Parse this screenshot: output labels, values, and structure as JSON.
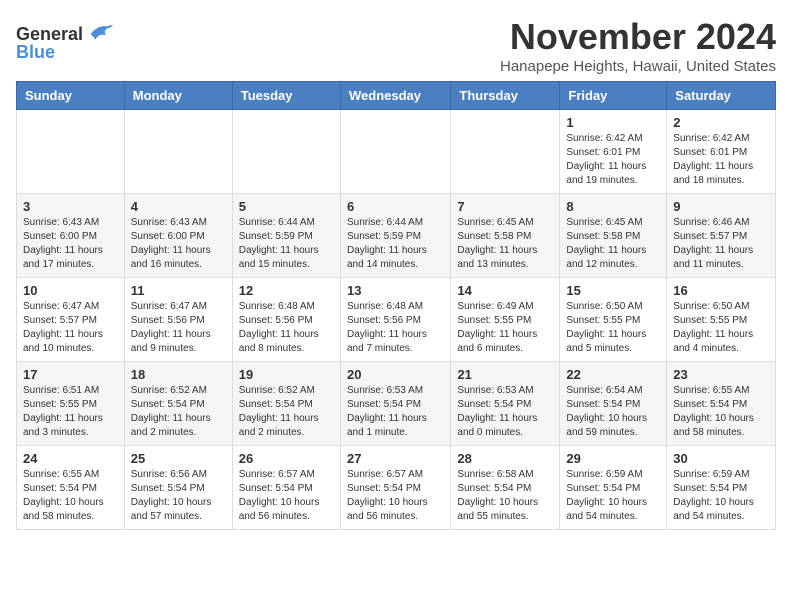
{
  "header": {
    "logo_general": "General",
    "logo_blue": "Blue",
    "title": "November 2024",
    "subtitle": "Hanapepe Heights, Hawaii, United States"
  },
  "weekdays": [
    "Sunday",
    "Monday",
    "Tuesday",
    "Wednesday",
    "Thursday",
    "Friday",
    "Saturday"
  ],
  "weeks": [
    [
      {
        "day": "",
        "info": ""
      },
      {
        "day": "",
        "info": ""
      },
      {
        "day": "",
        "info": ""
      },
      {
        "day": "",
        "info": ""
      },
      {
        "day": "",
        "info": ""
      },
      {
        "day": "1",
        "info": "Sunrise: 6:42 AM\nSunset: 6:01 PM\nDaylight: 11 hours and 19 minutes."
      },
      {
        "day": "2",
        "info": "Sunrise: 6:42 AM\nSunset: 6:01 PM\nDaylight: 11 hours and 18 minutes."
      }
    ],
    [
      {
        "day": "3",
        "info": "Sunrise: 6:43 AM\nSunset: 6:00 PM\nDaylight: 11 hours and 17 minutes."
      },
      {
        "day": "4",
        "info": "Sunrise: 6:43 AM\nSunset: 6:00 PM\nDaylight: 11 hours and 16 minutes."
      },
      {
        "day": "5",
        "info": "Sunrise: 6:44 AM\nSunset: 5:59 PM\nDaylight: 11 hours and 15 minutes."
      },
      {
        "day": "6",
        "info": "Sunrise: 6:44 AM\nSunset: 5:59 PM\nDaylight: 11 hours and 14 minutes."
      },
      {
        "day": "7",
        "info": "Sunrise: 6:45 AM\nSunset: 5:58 PM\nDaylight: 11 hours and 13 minutes."
      },
      {
        "day": "8",
        "info": "Sunrise: 6:45 AM\nSunset: 5:58 PM\nDaylight: 11 hours and 12 minutes."
      },
      {
        "day": "9",
        "info": "Sunrise: 6:46 AM\nSunset: 5:57 PM\nDaylight: 11 hours and 11 minutes."
      }
    ],
    [
      {
        "day": "10",
        "info": "Sunrise: 6:47 AM\nSunset: 5:57 PM\nDaylight: 11 hours and 10 minutes."
      },
      {
        "day": "11",
        "info": "Sunrise: 6:47 AM\nSunset: 5:56 PM\nDaylight: 11 hours and 9 minutes."
      },
      {
        "day": "12",
        "info": "Sunrise: 6:48 AM\nSunset: 5:56 PM\nDaylight: 11 hours and 8 minutes."
      },
      {
        "day": "13",
        "info": "Sunrise: 6:48 AM\nSunset: 5:56 PM\nDaylight: 11 hours and 7 minutes."
      },
      {
        "day": "14",
        "info": "Sunrise: 6:49 AM\nSunset: 5:55 PM\nDaylight: 11 hours and 6 minutes."
      },
      {
        "day": "15",
        "info": "Sunrise: 6:50 AM\nSunset: 5:55 PM\nDaylight: 11 hours and 5 minutes."
      },
      {
        "day": "16",
        "info": "Sunrise: 6:50 AM\nSunset: 5:55 PM\nDaylight: 11 hours and 4 minutes."
      }
    ],
    [
      {
        "day": "17",
        "info": "Sunrise: 6:51 AM\nSunset: 5:55 PM\nDaylight: 11 hours and 3 minutes."
      },
      {
        "day": "18",
        "info": "Sunrise: 6:52 AM\nSunset: 5:54 PM\nDaylight: 11 hours and 2 minutes."
      },
      {
        "day": "19",
        "info": "Sunrise: 6:52 AM\nSunset: 5:54 PM\nDaylight: 11 hours and 2 minutes."
      },
      {
        "day": "20",
        "info": "Sunrise: 6:53 AM\nSunset: 5:54 PM\nDaylight: 11 hours and 1 minute."
      },
      {
        "day": "21",
        "info": "Sunrise: 6:53 AM\nSunset: 5:54 PM\nDaylight: 11 hours and 0 minutes."
      },
      {
        "day": "22",
        "info": "Sunrise: 6:54 AM\nSunset: 5:54 PM\nDaylight: 10 hours and 59 minutes."
      },
      {
        "day": "23",
        "info": "Sunrise: 6:55 AM\nSunset: 5:54 PM\nDaylight: 10 hours and 58 minutes."
      }
    ],
    [
      {
        "day": "24",
        "info": "Sunrise: 6:55 AM\nSunset: 5:54 PM\nDaylight: 10 hours and 58 minutes."
      },
      {
        "day": "25",
        "info": "Sunrise: 6:56 AM\nSunset: 5:54 PM\nDaylight: 10 hours and 57 minutes."
      },
      {
        "day": "26",
        "info": "Sunrise: 6:57 AM\nSunset: 5:54 PM\nDaylight: 10 hours and 56 minutes."
      },
      {
        "day": "27",
        "info": "Sunrise: 6:57 AM\nSunset: 5:54 PM\nDaylight: 10 hours and 56 minutes."
      },
      {
        "day": "28",
        "info": "Sunrise: 6:58 AM\nSunset: 5:54 PM\nDaylight: 10 hours and 55 minutes."
      },
      {
        "day": "29",
        "info": "Sunrise: 6:59 AM\nSunset: 5:54 PM\nDaylight: 10 hours and 54 minutes."
      },
      {
        "day": "30",
        "info": "Sunrise: 6:59 AM\nSunset: 5:54 PM\nDaylight: 10 hours and 54 minutes."
      }
    ]
  ]
}
